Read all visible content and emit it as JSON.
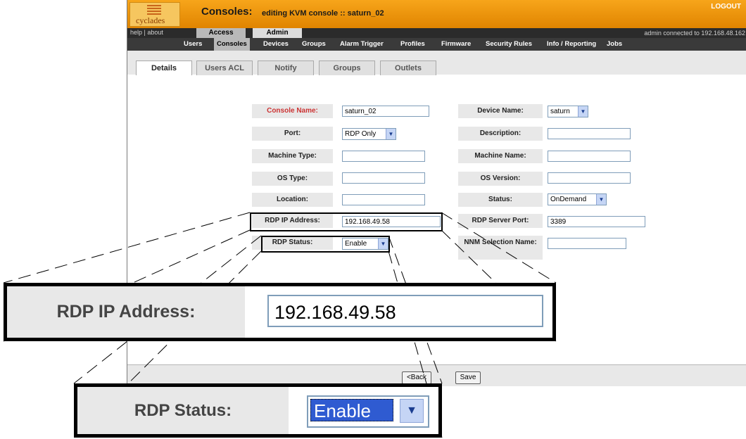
{
  "header": {
    "logo_text": "cyclades",
    "title": "Consoles:",
    "subtitle": "editing KVM console :: saturn_02",
    "logout": "LOGOUT"
  },
  "topnav": {
    "help": "help",
    "separator": "|",
    "about": "about",
    "tabs": [
      {
        "label": "Access"
      },
      {
        "label": "Admin"
      }
    ],
    "connected": "admin connected to 192.168.48.162"
  },
  "subnav": [
    "Users",
    "Consoles",
    "Devices",
    "Groups",
    "Alarm Trigger",
    "Profiles",
    "Firmware",
    "Security Rules",
    "Info / Reporting",
    "Jobs"
  ],
  "page_tabs": [
    "Details",
    "Users ACL",
    "Notify",
    "Groups",
    "Outlets"
  ],
  "form": {
    "left": [
      {
        "label": "Console Name:",
        "value": "saturn_02"
      },
      {
        "label": "Port:",
        "value": "RDP Only"
      },
      {
        "label": "Machine Type:",
        "value": ""
      },
      {
        "label": "OS Type:",
        "value": ""
      },
      {
        "label": "Location:",
        "value": ""
      },
      {
        "label": "RDP IP Address:",
        "value": "192.168.49.58"
      },
      {
        "label": "RDP Status:",
        "value": "Enable"
      }
    ],
    "right": [
      {
        "label": "Device Name:",
        "value": "saturn"
      },
      {
        "label": "Description:",
        "value": ""
      },
      {
        "label": "Machine Name:",
        "value": ""
      },
      {
        "label": "OS Version:",
        "value": ""
      },
      {
        "label": "Status:",
        "value": "OnDemand"
      },
      {
        "label": "RDP Server Port:",
        "value": "3389"
      },
      {
        "label": "NNM Selection Name:",
        "value": ""
      }
    ]
  },
  "buttons": {
    "back": "<Back",
    "save": "Save"
  },
  "zoom": {
    "ip_label": "RDP IP Address:",
    "ip_value": "192.168.49.58",
    "status_label": "RDP Status:",
    "status_value": "Enable"
  },
  "icons": {
    "select_arrow": "chevron-down-icon"
  },
  "colors": {
    "header_orange": "#f39a12",
    "required_label_red": "#cc3333",
    "select_highlight": "#2f5bd1"
  }
}
